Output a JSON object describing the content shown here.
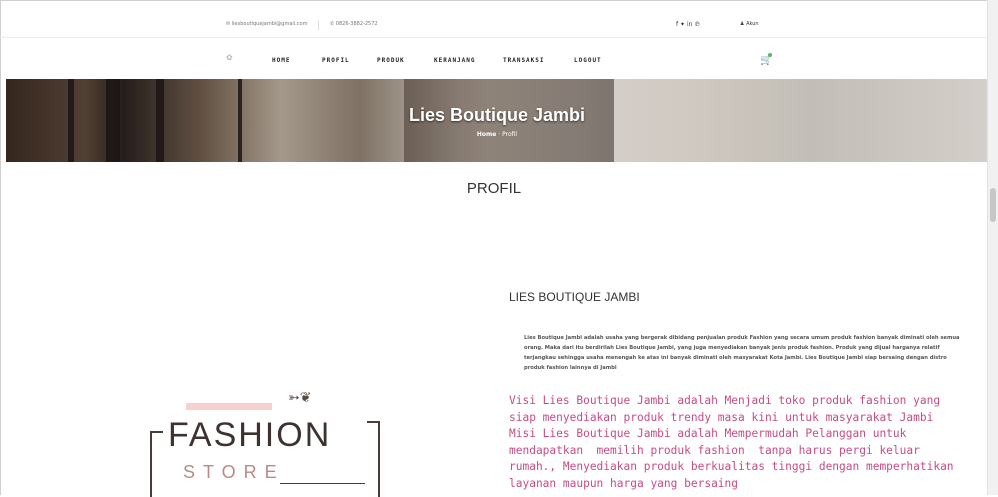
{
  "topbar": {
    "email": "✉ liesboutiquejambi@gmail.com",
    "phone": "✆ 0826-3882-2572",
    "social": "f  ✦  in  ℗",
    "account": "♟ Akun"
  },
  "nav": {
    "links": [
      "HOME",
      "PROFIL",
      "PRODUK",
      "KERANJANG",
      "TRANSAKSI",
      "LOGOUT"
    ]
  },
  "hero": {
    "title": "Lies Boutique Jambi",
    "crumb_home": "Home",
    "crumb_current": "Profil"
  },
  "page": {
    "title": "PROFIL",
    "section_heading": "LIES BOUTIQUE JAMBI",
    "about": "Lies Boutique Jambi adalah usaha yang bergerak dibidang penjualan produk Fashion  yang secara umum produk fashion banyak diminati oleh semua orang. Maka dari itu berdirilah Lies Boutique Jambi, yang juga menyediakan banyak jenis produk fashion. Produk yang dijual harganya relatif terjangkau sehingga usaha menengah ke atas ini banyak diminati oleh masyarakat Kota Jambi. Lies Boutique Jambi siap bersaing dengan distro produk fashion lainnya di Jambi",
    "visi_misi": "Visi Lies Boutique Jambi adalah Menjadi toko produk fashion yang\nsiap menyediakan produk trendy masa kini untuk masyarakat Jambi\nMisi Lies Boutique Jambi adalah Mempermudah Pelanggan untuk\nmendapatkan  memilih produk fashion  tanpa harus pergi keluar\nrumah., Menyediakan produk berkualitas tinggi dengan memperhatikan\nlayanan maupun harga yang bersaing"
  },
  "logo": {
    "word": "FASHION",
    "sub": "STORE"
  },
  "colors": {
    "accent_pink": "#c84b86",
    "logo_pink": "#f6d2cf",
    "cart_badge": "#5cb85c"
  }
}
